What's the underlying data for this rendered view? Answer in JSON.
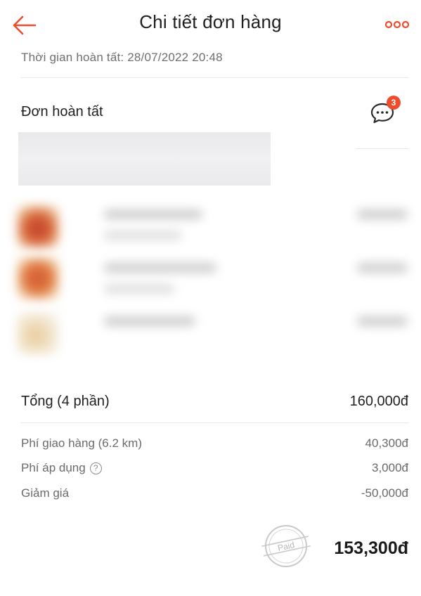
{
  "header": {
    "title": "Chi tiết đơn hàng",
    "back_icon": "arrow-left-icon",
    "more_icon": "more-horizontal-icon",
    "accent_color": "#ee4d2d"
  },
  "order": {
    "completed_time": "Thời gian hoàn tất: 28/07/2022 20:48",
    "status": "Đơn hoàn tất",
    "chat_icon": "chat-bubble-icon",
    "chat_badge": "3"
  },
  "summary": {
    "total_label": "Tổng (4 phần)",
    "total_value": "160,000đ",
    "fees": [
      {
        "label": "Phí giao hàng (6.2 km)",
        "value": "40,300đ"
      },
      {
        "label": "Phí áp dụng",
        "value": "3,000đ",
        "help_icon": "question-circle-icon"
      },
      {
        "label": "Giảm giá",
        "value": "-50,000đ"
      }
    ],
    "paid_stamp": "Paid",
    "grand_total": "153,300đ"
  }
}
